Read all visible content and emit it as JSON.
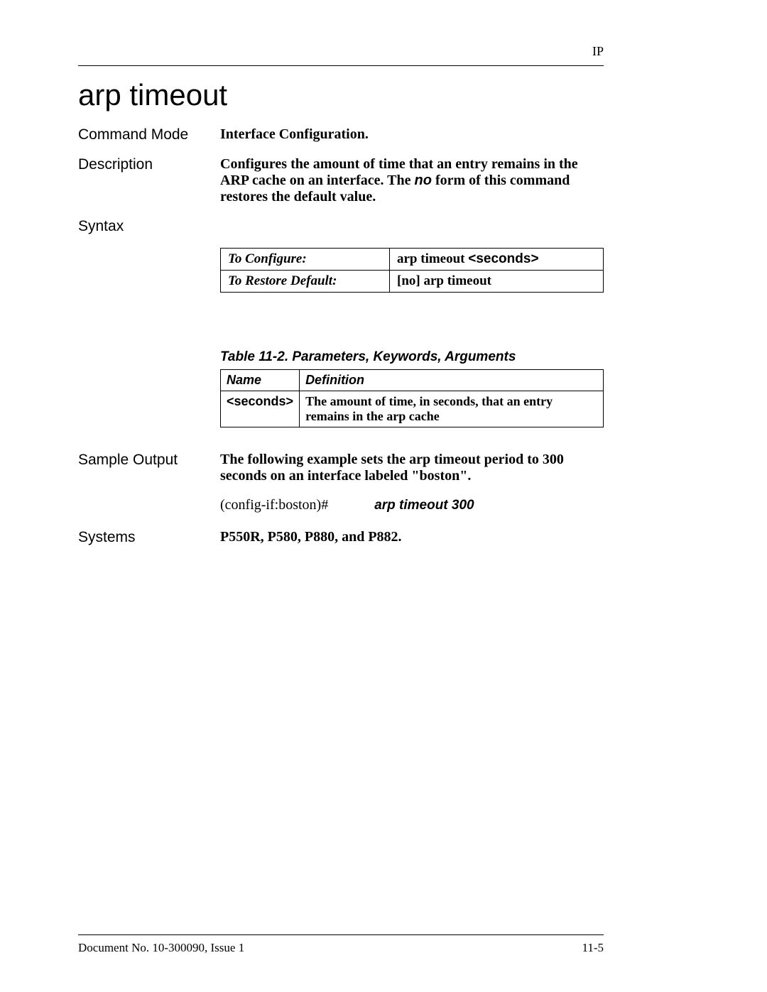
{
  "header": {
    "chapter": "IP"
  },
  "title": "arp timeout",
  "sections": {
    "command_mode": {
      "label": "Command Mode",
      "value": "Interface Configuration."
    },
    "description": {
      "label": "Description",
      "pre": "Configures the amount of time that an entry remains in the ARP cache on an interface. The ",
      "no": "no",
      "post": " form of this command restores the default value."
    },
    "syntax": {
      "label": "Syntax"
    },
    "sample_output": {
      "label": "Sample Output",
      "text": "The following example sets the arp timeout period to 300 seconds on an interface labeled \"boston\".",
      "prompt": "(config-if:boston)#",
      "command": "arp timeout 300"
    },
    "systems": {
      "label": "Systems",
      "value": "P550R, P580, P880, and P882."
    }
  },
  "syntax_table": {
    "configure": {
      "label": "To Configure:",
      "cmd_prefix": "arp timeout ",
      "cmd_arg": "<seconds>"
    },
    "restore": {
      "label": "To Restore Default:",
      "value": "[no] arp timeout"
    }
  },
  "param_table": {
    "caption": "Table 11-2. Parameters, Keywords, Arguments",
    "headers": {
      "name": "Name",
      "definition": "Definition"
    },
    "rows": [
      {
        "name": "<seconds>",
        "definition": "The amount of time, in seconds, that an entry remains in the arp cache"
      }
    ]
  },
  "footer": {
    "left": "Document No. 10-300090, Issue 1",
    "right": "11-5"
  }
}
